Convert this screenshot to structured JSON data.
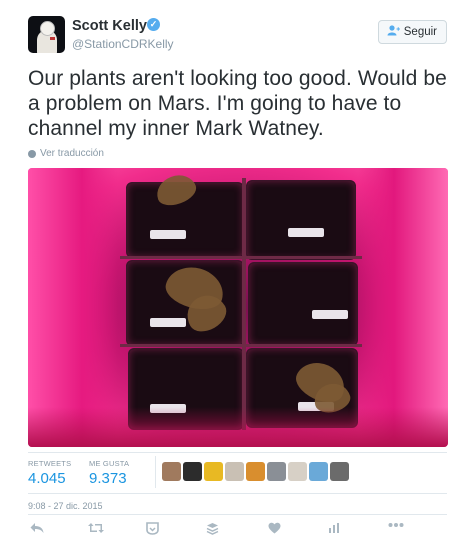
{
  "author": {
    "name": "Scott Kelly",
    "handle": "@StationCDRKelly",
    "verified_icon": "verified-badge-icon"
  },
  "follow": {
    "label": "Seguir",
    "icon": "add-user-icon"
  },
  "tweet": {
    "text": "Our plants aren't looking too good. Would be a problem on Mars. I'm going to have to channel my inner Mark Watney.",
    "translate_label": "Ver traducción"
  },
  "stats": {
    "retweets_label": "RETWEETS",
    "retweets_value": "4.045",
    "likes_label": "ME GUSTA",
    "likes_value": "9.373"
  },
  "likers": [
    "#a07a5e",
    "#2c2c2c",
    "#e8b923",
    "#c9c0b4",
    "#d98e2e",
    "#8a8f96",
    "#d7d0c6",
    "#6aa9d8",
    "#6b6b6b"
  ],
  "timestamp": "9:08 - 27 dic. 2015",
  "actions": [
    "reply-icon",
    "retweet-icon",
    "like-icon",
    "stack-icon",
    "heart-icon",
    "analytics-icon",
    "more-icon"
  ],
  "colors": {
    "accent": "#1b95e0",
    "muted": "#8899a6",
    "text": "#292f33"
  }
}
